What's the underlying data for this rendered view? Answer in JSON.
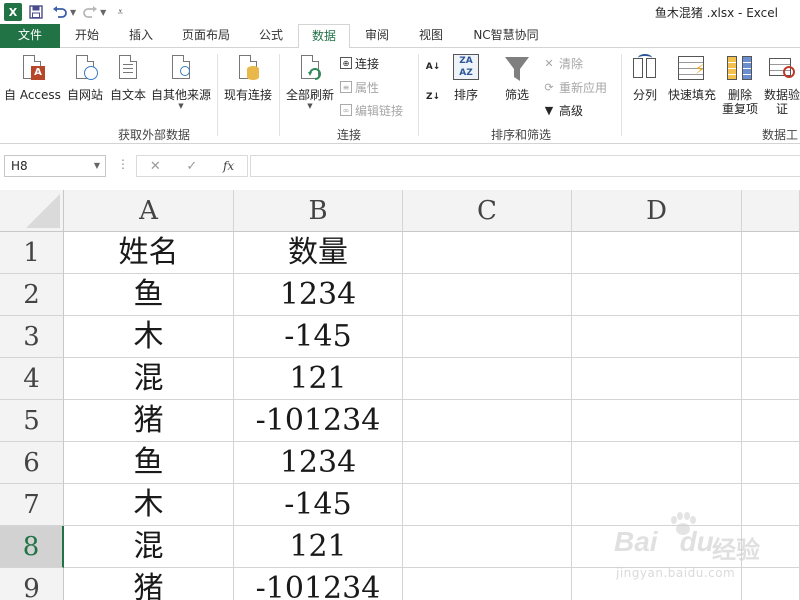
{
  "window": {
    "title": "鱼木混猪 .xlsx - Excel",
    "app_icon": "X"
  },
  "tabs": [
    {
      "label": "文件",
      "kind": "file"
    },
    {
      "label": "开始"
    },
    {
      "label": "插入"
    },
    {
      "label": "页面布局"
    },
    {
      "label": "公式"
    },
    {
      "label": "数据",
      "active": true
    },
    {
      "label": "审阅"
    },
    {
      "label": "视图"
    },
    {
      "label": "NC智慧协同"
    }
  ],
  "ribbon": {
    "external": {
      "group_label": "获取外部数据",
      "access": "自 Access",
      "web": "自网站",
      "text": "自文本",
      "other": "自其他来源",
      "existing": "现有连接"
    },
    "connections": {
      "group_label": "连接",
      "refresh_all": "全部刷新",
      "connections": "连接",
      "properties": "属性",
      "edit_links": "编辑链接"
    },
    "sort_filter": {
      "group_label": "排序和筛选",
      "sort": "排序",
      "filter": "筛选",
      "clear": "清除",
      "reapply": "重新应用",
      "advanced": "高级"
    },
    "data_tools": {
      "group_label": "数据工",
      "text_to_columns": "分列",
      "flash_fill": "快速填充",
      "remove_dup_1": "删除",
      "remove_dup_2": "重复项",
      "validation_1": "数据验",
      "validation_2": "证"
    }
  },
  "formula_bar": {
    "name_box": "H8",
    "cancel": "✕",
    "enter": "✓",
    "fx": "fx",
    "value": ""
  },
  "sheet": {
    "columns": [
      "A",
      "B",
      "C",
      "D"
    ],
    "rows": [
      {
        "num": "1",
        "a": "姓名",
        "b": "数量"
      },
      {
        "num": "2",
        "a": "鱼",
        "b": "1234"
      },
      {
        "num": "3",
        "a": "木",
        "b": "-145"
      },
      {
        "num": "4",
        "a": "混",
        "b": "121"
      },
      {
        "num": "5",
        "a": "猪",
        "b": "-101234"
      },
      {
        "num": "6",
        "a": "鱼",
        "b": "1234"
      },
      {
        "num": "7",
        "a": "木",
        "b": "-145"
      },
      {
        "num": "8",
        "a": "混",
        "b": "121"
      },
      {
        "num": "9",
        "a": "猪",
        "b": "-101234"
      }
    ],
    "selected_row": "8"
  },
  "watermark": {
    "brand": "Bai",
    "brand_suffix": "du",
    "cn": "经验",
    "url": "jingyan.baidu.com"
  },
  "colors": {
    "excel_green": "#217346",
    "header_bg": "#f3f3f3",
    "grid_line": "#d4d4d4"
  }
}
